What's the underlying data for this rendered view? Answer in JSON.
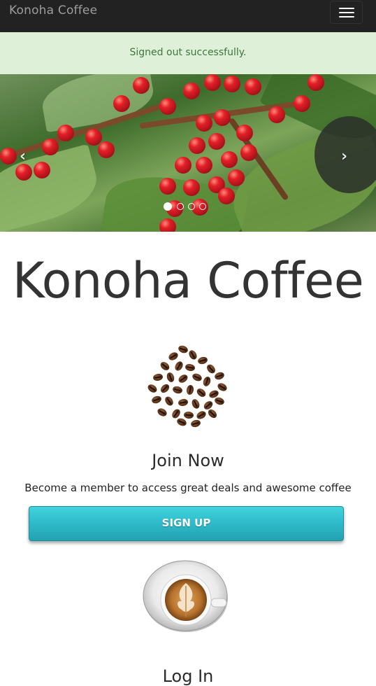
{
  "navbar": {
    "brand": "Konoha Coffee",
    "toggle_icon": "hamburger-menu-icon"
  },
  "alert": {
    "message": "Signed out successfully."
  },
  "carousel": {
    "slide_count": 4,
    "active_slide": 1,
    "prev_icon": "chevron-left-icon",
    "next_icon": "chevron-right-icon",
    "prev_glyph": "‹",
    "next_glyph": "›"
  },
  "hero": {
    "title": "Konoha Coffee"
  },
  "join": {
    "title": "Join Now",
    "description": "Become a member to access great deals and awesome coffee",
    "button_label": "SIGN UP"
  },
  "login": {
    "title": "Log In"
  },
  "colors": {
    "navbar_bg": "#222222",
    "alert_bg": "#dff0d8",
    "alert_text": "#3c763d",
    "signup_button": "#30bccb"
  }
}
